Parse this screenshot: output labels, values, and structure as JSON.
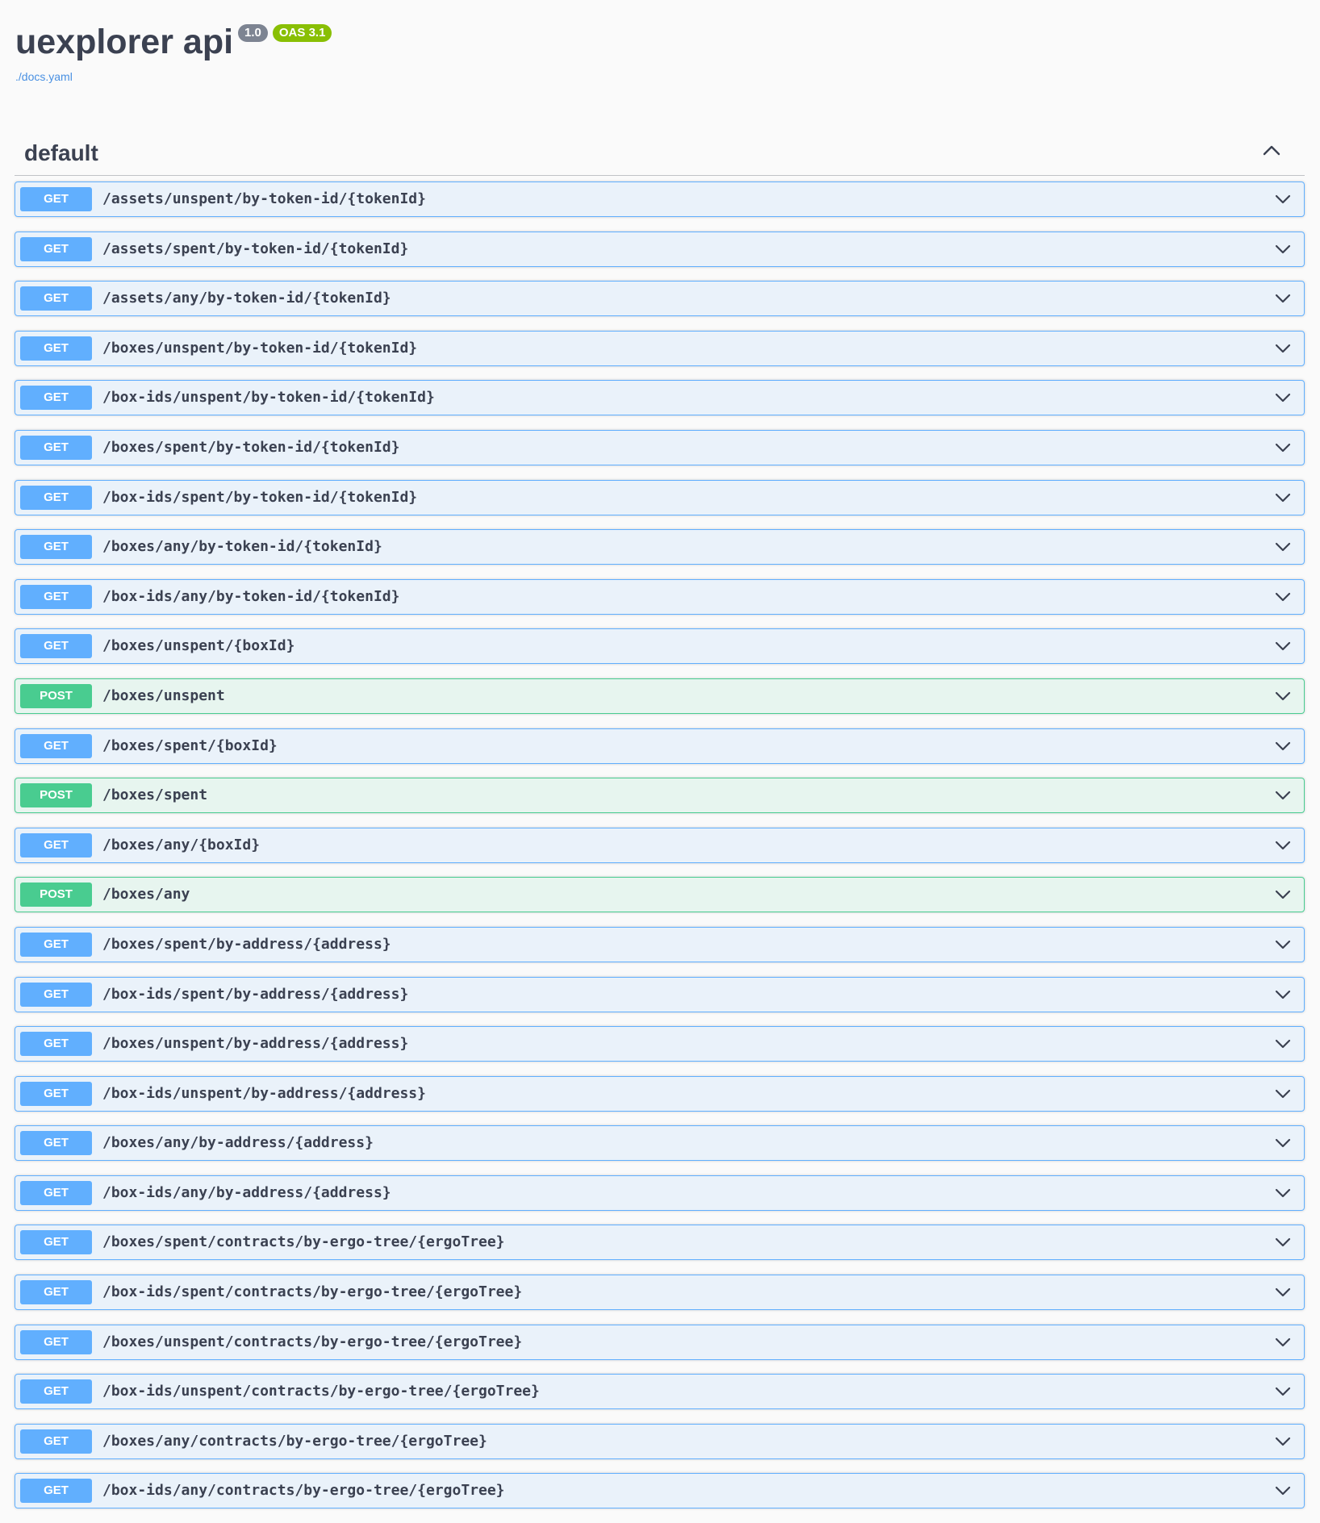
{
  "info": {
    "title": "uexplorer api",
    "version": "1.0",
    "oas": "OAS 3.1",
    "spec_url": "./docs.yaml"
  },
  "tag": {
    "name": "default",
    "expanded": true
  },
  "colors": {
    "get": "#61affe",
    "post": "#49cc90",
    "text": "#3b4151",
    "link": "#4990e2"
  },
  "operations": [
    {
      "method": "GET",
      "path": "/assets/unspent/by-token-id/{tokenId}"
    },
    {
      "method": "GET",
      "path": "/assets/spent/by-token-id/{tokenId}"
    },
    {
      "method": "GET",
      "path": "/assets/any/by-token-id/{tokenId}"
    },
    {
      "method": "GET",
      "path": "/boxes/unspent/by-token-id/{tokenId}"
    },
    {
      "method": "GET",
      "path": "/box-ids/unspent/by-token-id/{tokenId}"
    },
    {
      "method": "GET",
      "path": "/boxes/spent/by-token-id/{tokenId}"
    },
    {
      "method": "GET",
      "path": "/box-ids/spent/by-token-id/{tokenId}"
    },
    {
      "method": "GET",
      "path": "/boxes/any/by-token-id/{tokenId}"
    },
    {
      "method": "GET",
      "path": "/box-ids/any/by-token-id/{tokenId}"
    },
    {
      "method": "GET",
      "path": "/boxes/unspent/{boxId}"
    },
    {
      "method": "POST",
      "path": "/boxes/unspent"
    },
    {
      "method": "GET",
      "path": "/boxes/spent/{boxId}"
    },
    {
      "method": "POST",
      "path": "/boxes/spent"
    },
    {
      "method": "GET",
      "path": "/boxes/any/{boxId}"
    },
    {
      "method": "POST",
      "path": "/boxes/any"
    },
    {
      "method": "GET",
      "path": "/boxes/spent/by-address/{address}"
    },
    {
      "method": "GET",
      "path": "/box-ids/spent/by-address/{address}"
    },
    {
      "method": "GET",
      "path": "/boxes/unspent/by-address/{address}"
    },
    {
      "method": "GET",
      "path": "/box-ids/unspent/by-address/{address}"
    },
    {
      "method": "GET",
      "path": "/boxes/any/by-address/{address}"
    },
    {
      "method": "GET",
      "path": "/box-ids/any/by-address/{address}"
    },
    {
      "method": "GET",
      "path": "/boxes/spent/contracts/by-ergo-tree/{ergoTree}"
    },
    {
      "method": "GET",
      "path": "/box-ids/spent/contracts/by-ergo-tree/{ergoTree}"
    },
    {
      "method": "GET",
      "path": "/boxes/unspent/contracts/by-ergo-tree/{ergoTree}"
    },
    {
      "method": "GET",
      "path": "/box-ids/unspent/contracts/by-ergo-tree/{ergoTree}"
    },
    {
      "method": "GET",
      "path": "/boxes/any/contracts/by-ergo-tree/{ergoTree}"
    },
    {
      "method": "GET",
      "path": "/box-ids/any/contracts/by-ergo-tree/{ergoTree}"
    }
  ]
}
